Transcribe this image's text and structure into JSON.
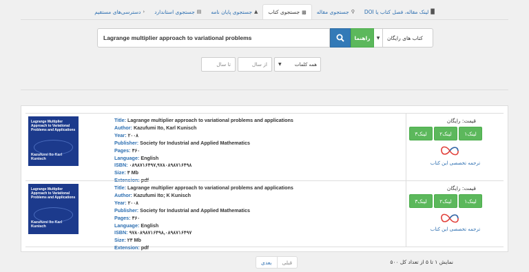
{
  "nav": {
    "tabs": [
      {
        "label": "لینک مقاله، فصل کتاب یا DOI",
        "icon": "book-icon"
      },
      {
        "label": "جستجوی مقاله",
        "icon": "search-icon"
      },
      {
        "label": "جستجوی کتاب",
        "icon": "book-icon"
      },
      {
        "label": "جستجوی پایان نامه",
        "icon": "graduation-cap-icon"
      },
      {
        "label": "جستجوی استاندارد",
        "icon": "document-icon"
      },
      {
        "label": "دسترسی‌های مستقیم",
        "icon": "chevron-left-icon"
      }
    ]
  },
  "search": {
    "query": "Lagrange multiplier approach to variational problems",
    "help_label": "راهنما",
    "type_label": "کتاب های رایگان"
  },
  "filters": {
    "to_year_placeholder": "تا سال",
    "from_year_placeholder": "از سال",
    "words_label": "همه کلمات"
  },
  "field_labels": {
    "title": "Title:",
    "author": "Author:",
    "year": "Year:",
    "publisher": "Publisher:",
    "pages": "Pages:",
    "language": "Language:",
    "isbn": "ISBN:",
    "size": "Size:",
    "extension": "Extension:"
  },
  "results": [
    {
      "cover_title": "Lagrange Multiplier Approach to Variational Problems and Applications",
      "cover_authors": "Kazufumi Ito Karl Kunisch",
      "title": "Lagrange multiplier approach to variational problems and applications",
      "author": "Kazufumi Ito, Karl Kunisch",
      "year": "۲۰۰۸",
      "publisher": "Society for Industrial and Applied Mathematics",
      "pages": "۳۶۰",
      "language": "English",
      "isbn": "۰۸۹۸۷۱۶۴۹۷,۹۷۸۰۸۹۸۷۱۶۴۹۸",
      "size": "۳ Mb",
      "extension": "pdf",
      "price": "قیمت: رایگان",
      "links": [
        "لینک۱",
        "لینک۲",
        "لینک۳"
      ],
      "translate_label": "ترجمه تخصصی این کتاب"
    },
    {
      "cover_title": "Lagrange Multiplier Approach to Variational Problems and Applications",
      "cover_authors": "Kazufumi Ito Karl Kunisch",
      "title": "Lagrange multiplier approach to variational problems and applications",
      "author": "Kazufumi Ito; K Kunisch",
      "year": "۲۰۰۸",
      "publisher": "Society for Industrial and Applied Mathematics",
      "pages": "۳۶۰",
      "language": "English",
      "isbn": "۹۷۸۰۸۹۸۷۱۶۴۹۸,۰۸۹۸۷۱۶۴۹۷",
      "size": "۲۳ Mb",
      "extension": "pdf",
      "price": "قیمت: رایگان",
      "links": [
        "لینک۱",
        "لینک۲",
        "لینک۳"
      ],
      "translate_label": "ترجمه تخصصی این کتاب"
    }
  ],
  "pagination": {
    "next_label": "بعدی",
    "prev_label": "قبلی",
    "summary": "نمایش ۱ تا ۵ از تعداد کل ۵۰۰"
  },
  "colors": {
    "primary": "#337ab7",
    "success": "#5cb85c",
    "link": "#2a6db0",
    "cover": "#1c3a8c"
  }
}
